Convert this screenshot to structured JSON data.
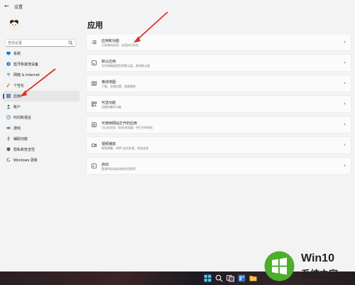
{
  "window": {
    "title": "设置",
    "back_glyph": "←"
  },
  "search": {
    "value": "",
    "placeholder": "查找设置"
  },
  "sidebar": {
    "items": [
      {
        "label": "系统",
        "icon": "monitor-icon",
        "color": "#0078d4",
        "active": false
      },
      {
        "label": "蓝牙和其他设备",
        "icon": "bluetooth-icon",
        "color": "#0067c0",
        "active": false
      },
      {
        "label": "网络 & Internet",
        "icon": "wifi-icon",
        "color": "#4a6fa5",
        "active": false
      },
      {
        "label": "个性化",
        "icon": "brush-icon",
        "color": "#c06a2b",
        "active": false
      },
      {
        "label": "应用",
        "icon": "apps-icon",
        "color": "#3f5c8a",
        "active": true
      },
      {
        "label": "帐户",
        "icon": "person-icon",
        "color": "#1c8a4f",
        "active": false
      },
      {
        "label": "时间和语言",
        "icon": "globe-clock-icon",
        "color": "#2d7cc4",
        "active": false
      },
      {
        "label": "游戏",
        "icon": "gamepad-icon",
        "color": "#666666",
        "active": false
      },
      {
        "label": "辅助功能",
        "icon": "accessibility-icon",
        "color": "#1c6fb8",
        "active": false
      },
      {
        "label": "隐私和安全性",
        "icon": "shield-icon",
        "color": "#5a5a5a",
        "active": false
      },
      {
        "label": "Windows 更新",
        "icon": "update-icon",
        "color": "#0078d4",
        "active": false
      }
    ]
  },
  "main": {
    "title": "应用",
    "cards": [
      {
        "title": "应用和功能",
        "desc": "已安装的应用、应用执行别名",
        "icon": "list-icon"
      },
      {
        "title": "默认应用",
        "desc": "文件和链接类型的默认值，其他默认值",
        "icon": "default-apps-icon"
      },
      {
        "title": "离线地图",
        "desc": "下载、存储位置、地图更新",
        "icon": "map-icon"
      },
      {
        "title": "可选功能",
        "desc": "设备的额外功能",
        "icon": "grid-plus-icon"
      },
      {
        "title": "可使用网站打开的应用",
        "desc": "可以在应用（而非浏览器）中打开的网站",
        "icon": "web-apps-icon"
      },
      {
        "title": "视频播放",
        "desc": "视频调整、HDR 流式处理、电池选项",
        "icon": "video-icon"
      },
      {
        "title": "启动",
        "desc": "登录时自动启动的应用程序",
        "icon": "startup-icon"
      }
    ],
    "chevron": "›"
  },
  "watermark": {
    "brand": "Win10",
    "sub": "系统之家"
  },
  "colors": {
    "accent": "#0067c0",
    "annotation_arrow": "#d9322a",
    "watermark_green": "#4caf2a"
  }
}
